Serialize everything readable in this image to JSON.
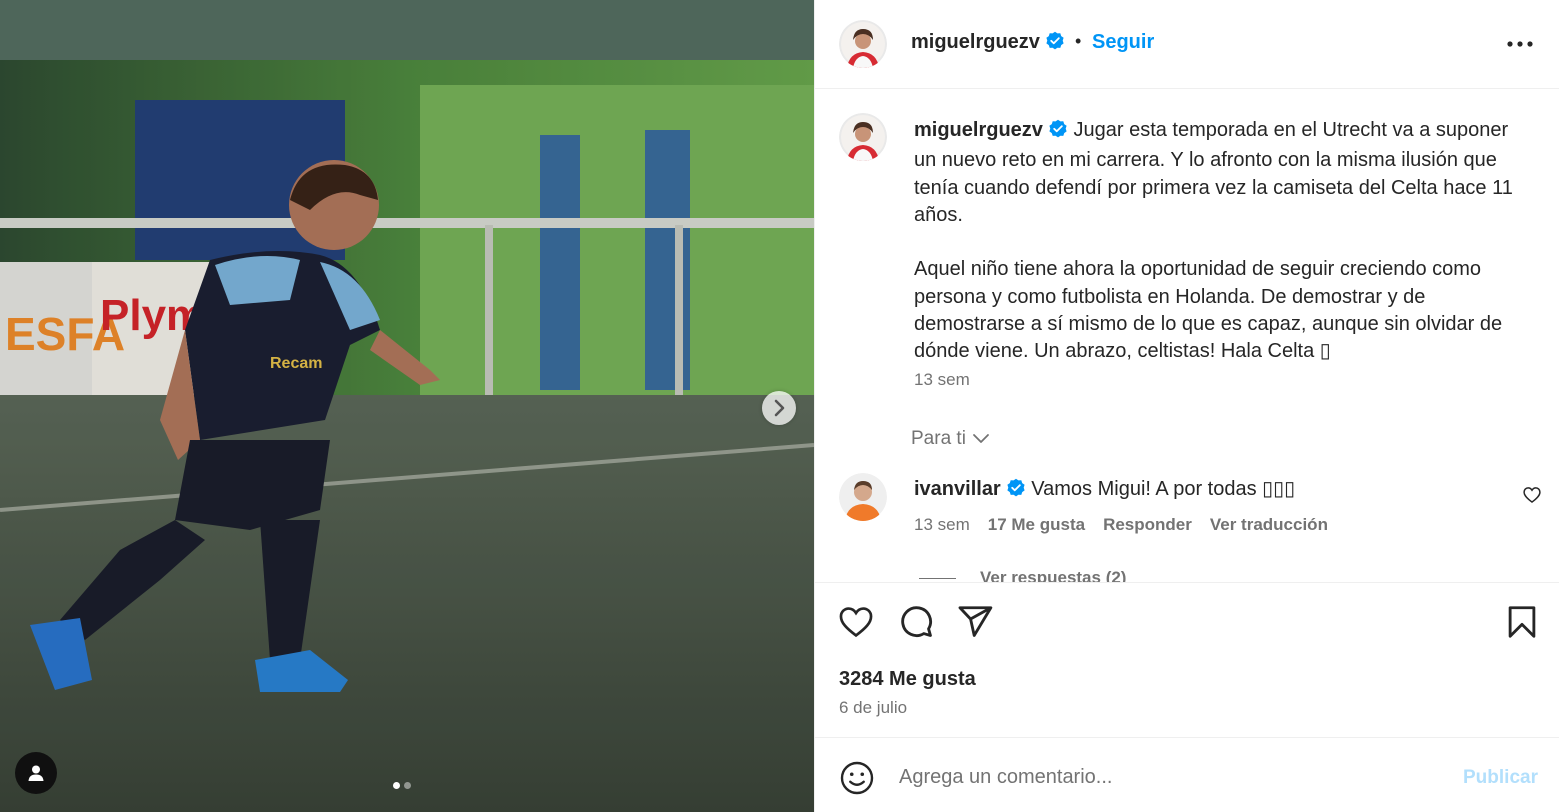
{
  "post": {
    "username": "miguelrguezv",
    "verified": true,
    "separator": "•",
    "follow_label": "Seguir",
    "more_icon": "more-horizontal-icon"
  },
  "media": {
    "carousel_index": 1,
    "carousel_count": 2,
    "next_icon": "chevron-right-icon",
    "tag_icon": "user-tag-icon",
    "photo_labels": {
      "banner_left": "ESFA",
      "banner_right": "Plym",
      "shirt_sponsor": "Recam"
    }
  },
  "caption": {
    "username": "miguelrguezv",
    "text": "Jugar esta temporada en el Utrecht va a suponer un nuevo reto en mi carrera. Y lo afronto con la misma ilusión que tenía cuando defendí por primera vez la camiseta del Celta hace 11 años.\n\nAquel niño tiene ahora la oportunidad de seguir creciendo como persona y como futbolista en Holanda. De demostrar y de demostrarse a sí mismo de lo que es capaz, aunque sin olvidar de dónde viene. Un abrazo, celtistas! Hala Celta ▯",
    "time": "13 sem"
  },
  "for_you": {
    "label": "Para ti",
    "icon": "chevron-down-icon"
  },
  "comments": [
    {
      "username": "ivanvillar",
      "verified": true,
      "text": "Vamos Migui! A por todas ▯▯▯",
      "time": "13 sem",
      "likes": "17 Me gusta",
      "reply_label": "Responder",
      "translate_label": "Ver traducción",
      "view_replies": "Ver respuestas (2)"
    }
  ],
  "actions": {
    "like_icon": "heart-icon",
    "comment_icon": "comment-icon",
    "share_icon": "send-icon",
    "save_icon": "bookmark-icon"
  },
  "stats": {
    "likes": "3284 Me gusta",
    "date": "6 de julio"
  },
  "comment_box": {
    "placeholder": "Agrega un comentario...",
    "publish_label": "Publicar",
    "emoji_icon": "emoji-icon"
  },
  "colors": {
    "accent": "#0095f6",
    "verified": "#0095f6",
    "secondary_text": "#737373",
    "publish_disabled": "#b2dffc"
  }
}
